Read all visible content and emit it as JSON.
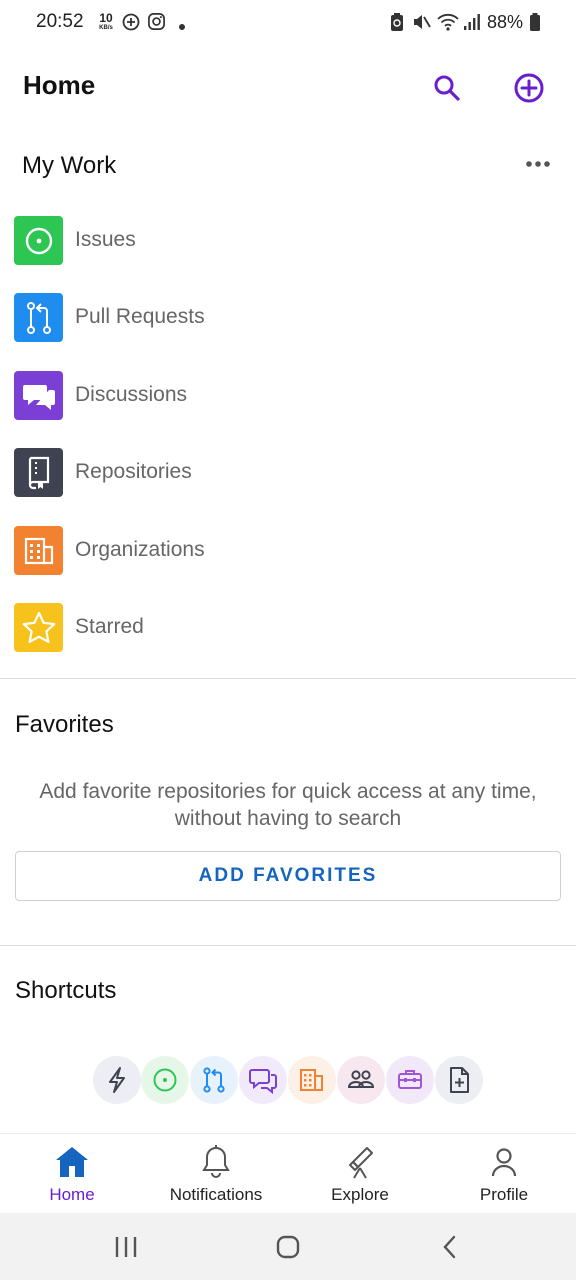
{
  "status_bar": {
    "time": "20:52",
    "speed_value": "10",
    "speed_unit": "KB/s",
    "battery": "88%"
  },
  "header": {
    "title": "Home"
  },
  "my_work": {
    "title": "My Work",
    "items": [
      {
        "label": "Issues",
        "icon": "issue-opened-icon",
        "color": "#2dc653"
      },
      {
        "label": "Pull Requests",
        "icon": "pull-request-icon",
        "color": "#1f8cf0"
      },
      {
        "label": "Discussions",
        "icon": "discussions-icon",
        "color": "#7b3fd6"
      },
      {
        "label": "Repositories",
        "icon": "repository-icon",
        "color": "#3f4250"
      },
      {
        "label": "Organizations",
        "icon": "organization-icon",
        "color": "#f28230"
      },
      {
        "label": "Starred",
        "icon": "star-icon",
        "color": "#f7c21c"
      }
    ]
  },
  "favorites": {
    "title": "Favorites",
    "description_line1": "Add favorite repositories for quick access at any time,",
    "description_line2": "without having to search",
    "button_label": "ADD FAVORITES"
  },
  "shortcuts": {
    "title": "Shortcuts",
    "items": [
      {
        "icon": "lightning-icon",
        "color": "#3f4250"
      },
      {
        "icon": "issue-opened-icon",
        "color": "#2dc653"
      },
      {
        "icon": "pull-request-icon",
        "color": "#1f8cf0"
      },
      {
        "icon": "discussions-icon",
        "color": "#7b3fd6"
      },
      {
        "icon": "organization-icon",
        "color": "#f28230"
      },
      {
        "icon": "people-icon",
        "color": "#3f4250"
      },
      {
        "icon": "briefcase-icon",
        "color": "#a256d6"
      },
      {
        "icon": "file-add-icon",
        "color": "#3f4250"
      }
    ]
  },
  "bottom_nav": {
    "items": [
      {
        "label": "Home",
        "icon": "home-icon",
        "active": true
      },
      {
        "label": "Notifications",
        "icon": "bell-icon",
        "active": false
      },
      {
        "label": "Explore",
        "icon": "telescope-icon",
        "active": false
      },
      {
        "label": "Profile",
        "icon": "person-icon",
        "active": false
      }
    ]
  },
  "colors": {
    "accent": "#6a1fcf",
    "link_blue": "#1565c0"
  }
}
